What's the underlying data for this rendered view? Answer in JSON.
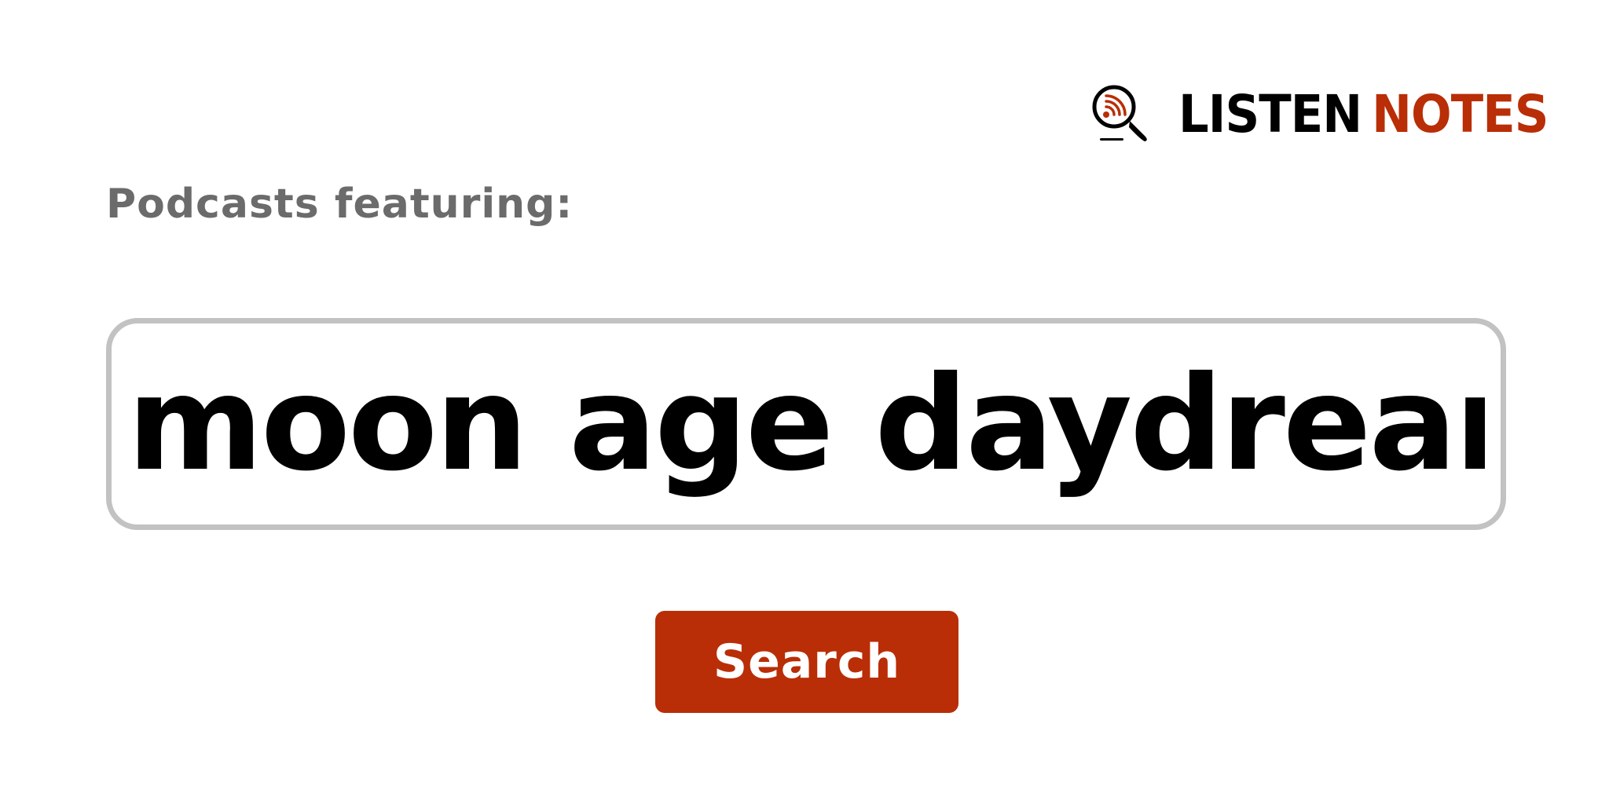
{
  "logo": {
    "word_1": "LISTEN",
    "word_2": "NOTES",
    "icon": "magnifier-podcast-icon"
  },
  "form": {
    "label": "Podcasts featuring:",
    "search_value": "moon age daydream",
    "button_label": "Search"
  },
  "colors": {
    "brand": "#b92e06",
    "label_gray": "#6b6b6b",
    "border_gray": "#c2c2c2",
    "text": "#000000",
    "background": "#ffffff"
  }
}
